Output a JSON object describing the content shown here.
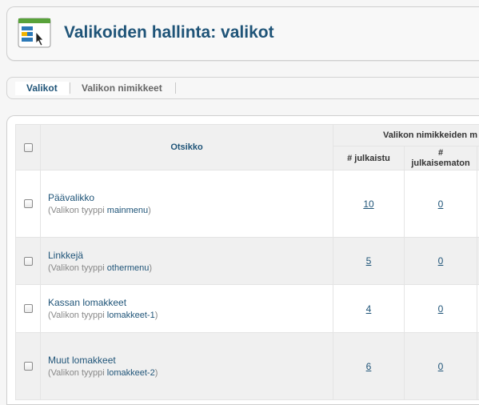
{
  "header": {
    "title": "Valikoiden hallinta: valikot",
    "icon": "menu-manager-icon"
  },
  "tabs": [
    {
      "label": "Valikot",
      "active": true
    },
    {
      "label": "Valikon nimikkeet",
      "active": false
    }
  ],
  "table": {
    "columns": {
      "title": "Otsikko",
      "group": "Valikon nimikkeiden m",
      "published": "# julkaistu",
      "unpublished_hash": "#",
      "unpublished": "julkaisematon"
    },
    "type_prefix": "(Valikon tyyppi ",
    "type_suffix": ")",
    "rows": [
      {
        "name": "Päävalikko",
        "type": "mainmenu",
        "published": "10",
        "unpublished": "0"
      },
      {
        "name": "Linkkejä",
        "type": "othermenu",
        "published": "5",
        "unpublished": "0"
      },
      {
        "name": "Kassan lomakkeet",
        "type": "lomakkeet-1",
        "published": "4",
        "unpublished": "0"
      },
      {
        "name": "Muut lomakkeet",
        "type": "lomakkeet-2",
        "published": "6",
        "unpublished": "0"
      }
    ]
  },
  "colors": {
    "title": "#1f5478",
    "link": "#1f5478",
    "muted": "#888888",
    "row_alt": "#f0f0f0"
  }
}
